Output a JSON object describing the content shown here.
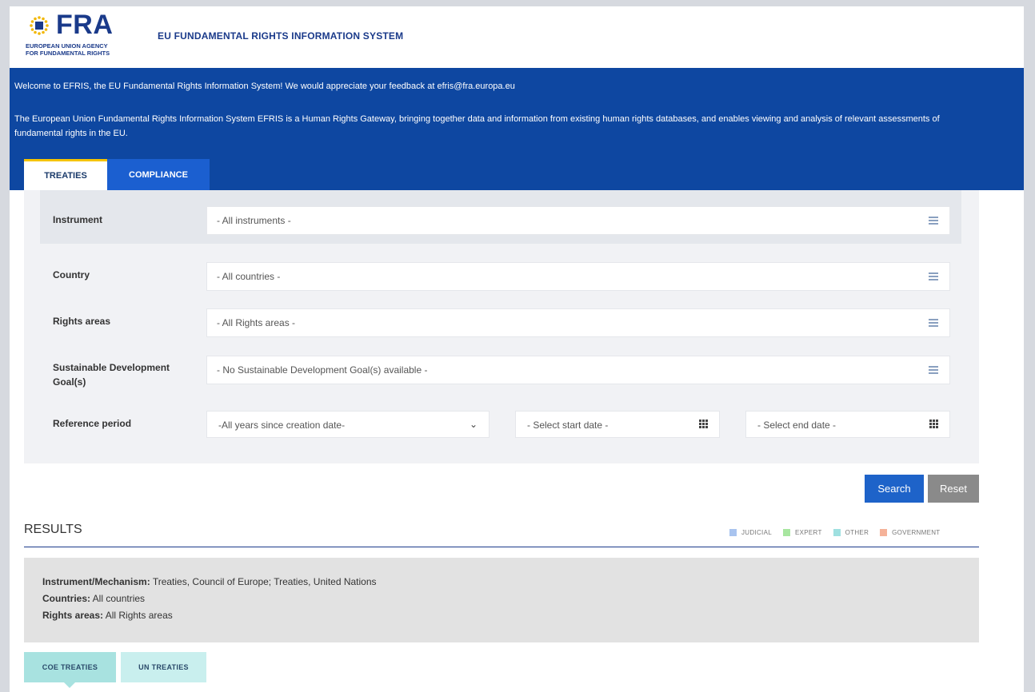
{
  "header": {
    "logo": {
      "wordmark": "FRA",
      "subtitle_line1": "EUROPEAN UNION AGENCY",
      "subtitle_line2": "FOR FUNDAMENTAL RIGHTS"
    },
    "site_title": "EU FUNDAMENTAL RIGHTS INFORMATION SYSTEM"
  },
  "banner": {
    "welcome": "Welcome to EFRIS, the EU Fundamental Rights Information System! We would appreciate your feedback at efris@fra.europa.eu",
    "description": "The European Union Fundamental Rights Information System EFRIS is a Human Rights Gateway, bringing together data and information from existing human rights databases, and enables viewing and analysis of relevant assessments of fundamental rights in the EU.",
    "tabs": [
      {
        "label": "TREATIES",
        "active": true
      },
      {
        "label": "COMPLIANCE",
        "active": false
      }
    ]
  },
  "filters": {
    "instrument": {
      "label": "Instrument",
      "placeholder": "- All instruments -"
    },
    "country": {
      "label": "Country",
      "placeholder": "- All countries -"
    },
    "rights_areas": {
      "label": "Rights areas",
      "placeholder": "- All Rights areas -"
    },
    "sdg": {
      "label": "Sustainable Development Goal(s)",
      "placeholder": "- No Sustainable Development Goal(s) available -"
    },
    "reference_period": {
      "label": "Reference period",
      "selected": "-All years since creation date-",
      "start_placeholder": "- Select start date -",
      "end_placeholder": "- Select end date -"
    }
  },
  "buttons": {
    "search": "Search",
    "reset": "Reset"
  },
  "results": {
    "title": "RESULTS",
    "legend": [
      {
        "label": "JUDICIAL",
        "color": "#a9c4ef"
      },
      {
        "label": "EXPERT",
        "color": "#a8e6a0"
      },
      {
        "label": "OTHER",
        "color": "#9fe0e0"
      },
      {
        "label": "GOVERNMENT",
        "color": "#f5b299"
      }
    ],
    "summary": {
      "instrument_label": "Instrument/Mechanism:",
      "instrument_value": "Treaties, Council of Europe; Treaties, United Nations",
      "countries_label": "Countries:",
      "countries_value": "All countries",
      "rights_label": "Rights areas:",
      "rights_value": "All Rights areas"
    },
    "subtabs": [
      {
        "label": "COE TREATIES",
        "active": true
      },
      {
        "label": "UN TREATIES",
        "active": false
      }
    ]
  }
}
